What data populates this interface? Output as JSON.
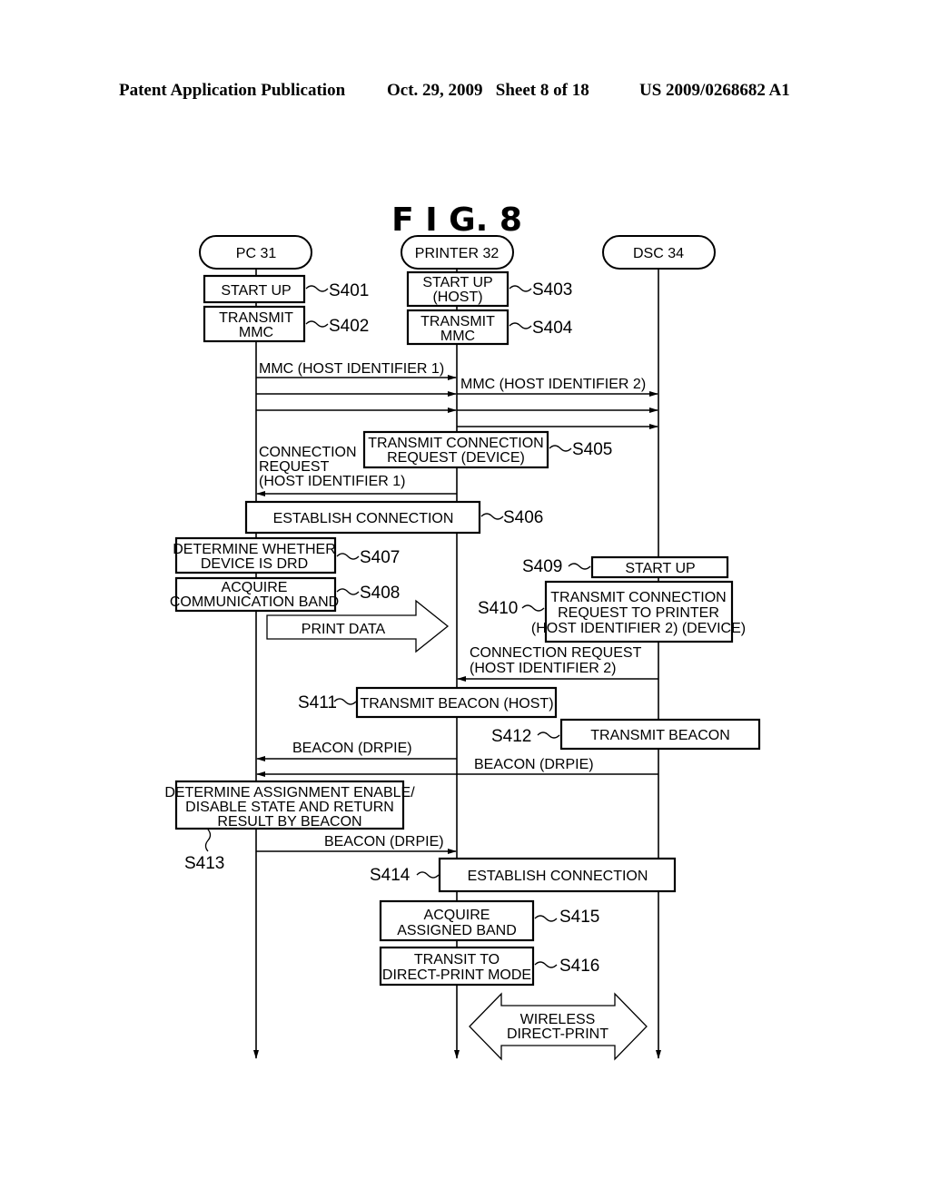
{
  "header": {
    "publication": "Patent Application Publication",
    "date_sheet": "Oct. 29, 2009   Sheet 8 of 18",
    "patent_number": "US 2009/0268682 A1"
  },
  "figure": {
    "title": "F I G.  8",
    "actors": [
      "PC  31",
      "PRINTER 32",
      "DSC  34"
    ],
    "boxes": {
      "s401": [
        "START UP"
      ],
      "s402": [
        "TRANSMIT",
        "MMC"
      ],
      "s403": [
        "START UP",
        "(HOST)"
      ],
      "s404": [
        "TRANSMIT",
        "MMC"
      ],
      "s405": [
        "TRANSMIT CONNECTION",
        "REQUEST (DEVICE)"
      ],
      "s406": [
        "ESTABLISH CONNECTION"
      ],
      "s407": [
        "DETERMINE WHETHER",
        "DEVICE IS DRD"
      ],
      "s408": [
        "ACQUIRE",
        "COMMUNICATION BAND"
      ],
      "s409": [
        "START UP"
      ],
      "s410": [
        "TRANSMIT CONNECTION",
        "REQUEST TO PRINTER",
        "(HOST IDENTIFIER 2) (DEVICE)"
      ],
      "s411": [
        "TRANSMIT BEACON (HOST)"
      ],
      "s412": [
        "TRANSMIT BEACON"
      ],
      "s413": [
        "DETERMINE ASSIGNMENT ENABLE/",
        "DISABLE STATE AND RETURN",
        "RESULT BY BEACON"
      ],
      "s414": [
        "ESTABLISH CONNECTION"
      ],
      "s415": [
        "ACQUIRE",
        "ASSIGNED BAND"
      ],
      "s416": [
        "TRANSIT TO",
        "DIRECT-PRINT MODE"
      ]
    },
    "step_labels": {
      "s401": "S401",
      "s402": "S402",
      "s403": "S403",
      "s404": "S404",
      "s405": "S405",
      "s406": "S406",
      "s407": "S407",
      "s408": "S408",
      "s409": "S409",
      "s410": "S410",
      "s411": "S411",
      "s412": "S412",
      "s413": "S413",
      "s414": "S414",
      "s415": "S415",
      "s416": "S416"
    },
    "messages": {
      "mmc1": "MMC (HOST IDENTIFIER 1)",
      "mmc2": "MMC (HOST IDENTIFIER 2)",
      "conn_req1": [
        "CONNECTION",
        "REQUEST",
        "(HOST IDENTIFIER 1)"
      ],
      "print_data": "PRINT DATA",
      "conn_req2": [
        "CONNECTION REQUEST",
        "(HOST IDENTIFIER 2)"
      ],
      "beacon_printer_to_pc": "BEACON (DRPIE)",
      "beacon_dsc_to_pc": "BEACON (DRPIE)",
      "beacon_pc_to_printer": "BEACON (DRPIE)",
      "wireless": [
        "WIRELESS",
        "DIRECT-PRINT"
      ]
    }
  }
}
